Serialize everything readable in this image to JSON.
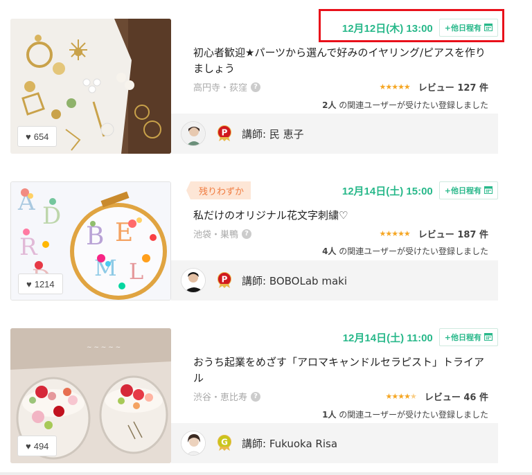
{
  "listings": [
    {
      "date": "12月12日(木) 13:00",
      "other_dates": "+他日程有",
      "title": "初心者歓迎★パーツから選んで好みのイヤリング/ピアスを作りましょう",
      "location": "高円寺・荻窪",
      "rating": 5,
      "review_label": "レビュー 127 件",
      "users_count": "2人",
      "users_text": " の関連ユーザーが受けたい登録しました",
      "likes": "654",
      "teacher": "講師: 民 恵子",
      "rank": "P",
      "rank_color": "#d0191f",
      "badge": ""
    },
    {
      "date": "12月14日(土) 15:00",
      "other_dates": "+他日程有",
      "title": "私だけのオリジナル花文字刺繍♡",
      "location": "池袋・巣鴨",
      "rating": 5,
      "review_label": "レビュー 187 件",
      "users_count": "4人",
      "users_text": " の関連ユーザーが受けたい登録しました",
      "likes": "1214",
      "teacher": "講師: BOBOLab maki",
      "rank": "P",
      "rank_color": "#d0191f",
      "badge": "残りわずか"
    },
    {
      "date": "12月14日(土) 11:00",
      "other_dates": "+他日程有",
      "title": "おうち起業をめざす「アロマキャンドルセラピスト」トライアル",
      "location": "渋谷・恵比寿",
      "rating": 4.5,
      "review_label": "レビュー 46 件",
      "users_count": "1人",
      "users_text": " の関連ユーザーが受けたい登録しました",
      "likes": "494",
      "teacher": "講師: Fukuoka Risa",
      "rank": "G",
      "rank_color": "#c9c51c",
      "badge": ""
    }
  ],
  "colors": {
    "accent": "#28b88a",
    "star": "#f5a623",
    "highlight": "#e8101a",
    "badge_text": "#f07b3f"
  },
  "icons": {
    "like": "heart-icon",
    "calendar": "calendar-icon",
    "help": "question-icon"
  }
}
